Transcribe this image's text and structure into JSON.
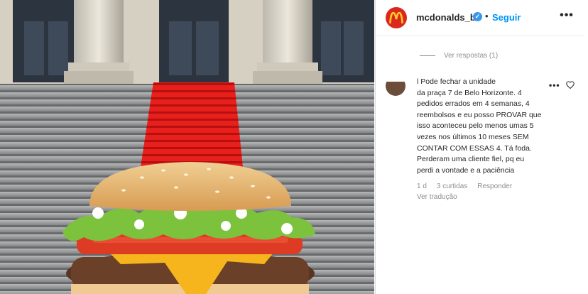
{
  "post": {
    "image_alt_hint": "",
    "account": {
      "username": "mcdonalds_br",
      "verified": true,
      "separator": "•",
      "follow_label": "Seguir",
      "more_label": "•••"
    },
    "replies_toggle": {
      "label": "Ver respostas (1)"
    },
    "comment": {
      "text": "l Pode fechar a unidade\nda praça 7 de Belo Horizonte. 4\npedidos errados em 4 semanas, 4\nreembolsos e eu posso PROVAR que\nisso aconteceu pelo menos umas 5\nvezes nos últimos 10 meses SEM\nCONTAR COM ESSAS 4. Tá foda.\nPerderam uma cliente fiel, pq eu\nperdi a vontade e a paciência",
      "age": "1 d",
      "likes": "3 curtidas",
      "reply_label": "Responder",
      "translate_label": "Ver tradução",
      "more_label": "•••"
    },
    "icons": {
      "logo": "mcdonalds-logo-icon",
      "verified": "verified-badge-icon",
      "heart": "heart-icon",
      "more": "more-options-icon"
    },
    "colors": {
      "brand_red": "#da291c",
      "brand_yellow": "#ffc72c",
      "link_blue": "#0095f6",
      "muted": "#8e8e8e",
      "text": "#262626"
    }
  }
}
